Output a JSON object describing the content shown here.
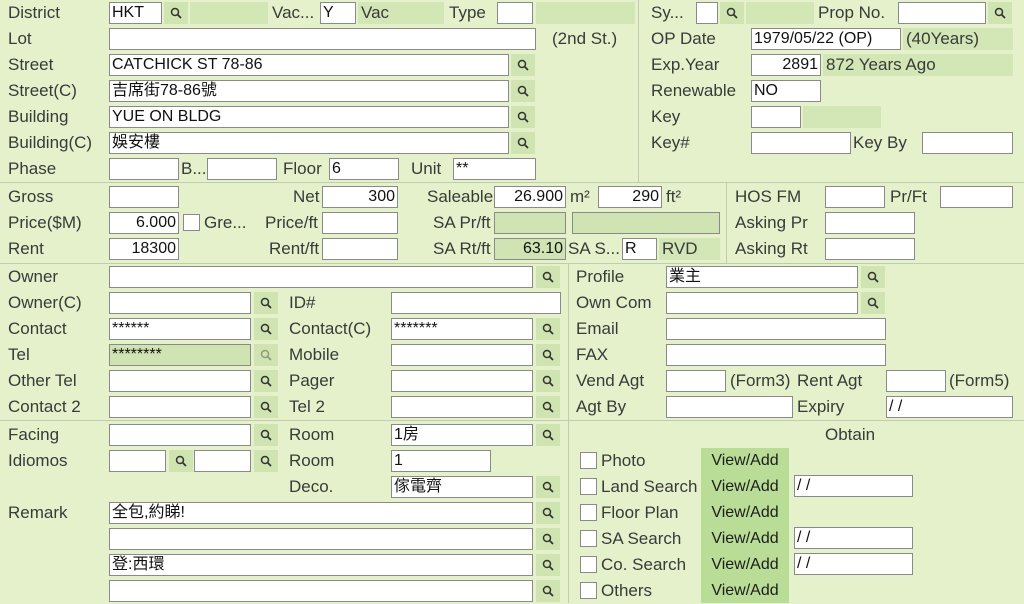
{
  "labels": {
    "district": "District",
    "vac": "Vac...",
    "vac2": "Vac",
    "type": "Type",
    "sy": "Sy...",
    "prop_no": "Prop No.",
    "lot": "Lot",
    "lot_suffix": "(2nd St.)",
    "op_date": "OP Date",
    "street": "Street",
    "exp_year": "Exp.Year",
    "street_c": "Street(C)",
    "renewable": "Renewable",
    "building": "Building",
    "key": "Key",
    "building_c": "Building(C)",
    "key_no": "Key#",
    "key_by": "Key By",
    "phase": "Phase",
    "block": "B...",
    "floor": "Floor",
    "unit": "Unit",
    "gross": "Gross",
    "net": "Net",
    "saleable": "Saleable",
    "m2": "m²",
    "ft2": "ft²",
    "hos_fm": "HOS FM",
    "pr_ft": "Pr/Ft",
    "price": "Price($M)",
    "gre": "Gre...",
    "price_ft": "Price/ft",
    "sa_pr_ft": "SA Pr/ft",
    "asking_pr": "Asking Pr",
    "rent": "Rent",
    "rent_ft": "Rent/ft",
    "sa_rt_ft": "SA Rt/ft",
    "sa_s": "SA S...",
    "rvd": "RVD",
    "asking_rt": "Asking Rt",
    "owner": "Owner",
    "profile": "Profile",
    "owner_c": "Owner(C)",
    "id_no": "ID#",
    "own_com": "Own Com",
    "contact": "Contact",
    "contact_c": "Contact(C)",
    "email": "Email",
    "tel": "Tel",
    "mobile": "Mobile",
    "fax": "FAX",
    "other_tel": "Other Tel",
    "pager": "Pager",
    "vend_agt": "Vend Agt",
    "form3": "(Form3)",
    "rent_agt": "Rent Agt",
    "form5": "(Form5)",
    "contact2": "Contact 2",
    "tel2": "Tel 2",
    "agt_by": "Agt By",
    "expiry": "Expiry",
    "facing": "Facing",
    "room": "Room",
    "obtain": "Obtain",
    "idiomos": "Idiomos",
    "room2": "Room",
    "deco": "Deco.",
    "remark": "Remark"
  },
  "values": {
    "district": "HKT",
    "vac": "Y",
    "type": "",
    "sy": "",
    "prop_no": "",
    "lot": "",
    "op_date": "1979/05/22 (OP)",
    "op_years": "(40Years)",
    "street": "CATCHICK ST 78-86",
    "exp_year": "2891",
    "exp_ago": "872 Years Ago",
    "street_c": "吉席街78-86號",
    "renewable": "NO",
    "building": "YUE ON BLDG",
    "key": "",
    "building_c": "娛安樓",
    "key_no": "",
    "key_by": "",
    "phase": "",
    "block": "",
    "floor": "6",
    "unit": "**",
    "gross": "",
    "net": "300",
    "saleable_m2": "26.900",
    "saleable_ft2": "290",
    "hos_fm": "",
    "pr_ft": "",
    "price": "6.000",
    "price_ft": "",
    "sa_pr_ft": "",
    "sa_pr_ft2": "",
    "asking_pr": "",
    "rent": "18300",
    "rent_ft": "",
    "sa_rt_ft": "63.10",
    "sa_s": "R",
    "asking_rt": "",
    "owner": "",
    "profile": "業主",
    "owner_c": "",
    "id_no": "",
    "own_com": "",
    "contact": "******",
    "contact_c": "*******",
    "email": "",
    "tel": "********",
    "mobile": "",
    "fax": "",
    "other_tel": "",
    "pager": "",
    "vend_agt": "",
    "rent_agt": "",
    "contact2": "",
    "tel2": "",
    "agt_by": "",
    "expiry": "/ /",
    "facing": "",
    "room": "1房",
    "idiomos1": "",
    "idiomos2": "",
    "room2": "1",
    "deco": "傢電齊",
    "remark1": "全包,約睇!",
    "remark2": "",
    "remark3": "登:西環",
    "remark4": ""
  },
  "obtain": {
    "view_add": "View/Add",
    "items": [
      {
        "label": "Photo",
        "date": null
      },
      {
        "label": "Land Search",
        "date": "/ /"
      },
      {
        "label": "Floor Plan",
        "date": null
      },
      {
        "label": "SA Search",
        "date": "/ /"
      },
      {
        "label": "Co. Search",
        "date": "/ /"
      },
      {
        "label": "Others",
        "date": null
      }
    ]
  },
  "icons": {
    "search": "search-icon",
    "checkbox": "checkbox-icon"
  },
  "colors": {
    "background": "#e4f1cb",
    "field": "#ffffff",
    "tint": "#d2e6b6",
    "button": "#b9dd96"
  }
}
